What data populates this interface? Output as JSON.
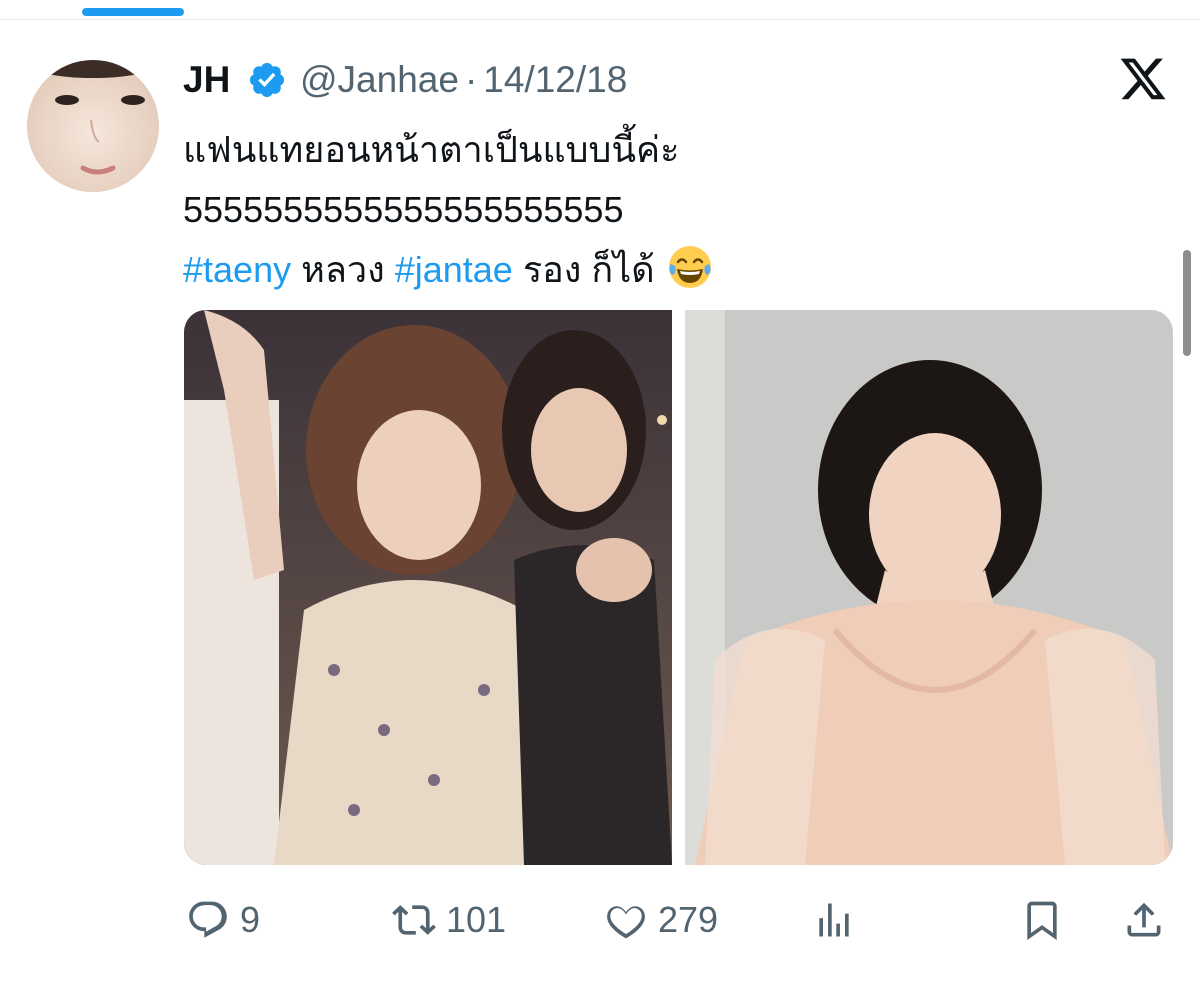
{
  "tweet": {
    "author_name": "JH",
    "handle": "@Janhae",
    "separator": "·",
    "date": "14/12/18",
    "text_line1": "แฟนแทยอนหน้าตาเป็นแบบนี้ค่ะ",
    "text_line2": "5555555555555555555555",
    "hashtag1": "#taeny",
    "word1": "หลวง",
    "hashtag2": "#jantae",
    "word2": "รอง ก็ได้",
    "emoji": "face-with-tears-of-joy"
  },
  "metrics": {
    "replies": "9",
    "retweets": "101",
    "likes": "279"
  },
  "colors": {
    "link": "#1d9bf0",
    "muted": "#536471",
    "text": "#0f1419",
    "verified": "#1d9bf0"
  },
  "icons": [
    "verified-badge-icon",
    "x-logo-icon",
    "reply-icon",
    "retweet-icon",
    "like-icon",
    "views-icon",
    "bookmark-icon",
    "share-icon"
  ]
}
